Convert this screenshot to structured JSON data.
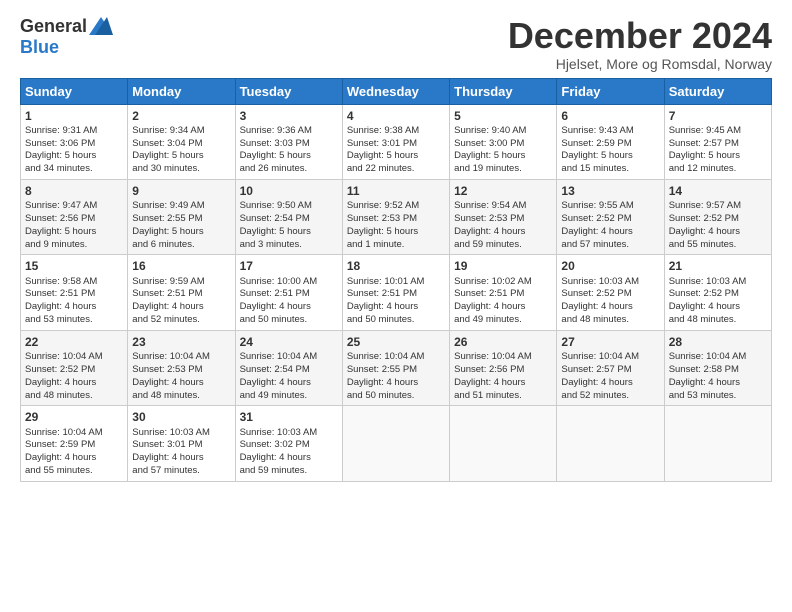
{
  "logo": {
    "general": "General",
    "blue": "Blue"
  },
  "title": "December 2024",
  "location": "Hjelset, More og Romsdal, Norway",
  "days_header": [
    "Sunday",
    "Monday",
    "Tuesday",
    "Wednesday",
    "Thursday",
    "Friday",
    "Saturday"
  ],
  "weeks": [
    [
      {
        "day": "1",
        "lines": [
          "Sunrise: 9:31 AM",
          "Sunset: 3:06 PM",
          "Daylight: 5 hours",
          "and 34 minutes."
        ]
      },
      {
        "day": "2",
        "lines": [
          "Sunrise: 9:34 AM",
          "Sunset: 3:04 PM",
          "Daylight: 5 hours",
          "and 30 minutes."
        ]
      },
      {
        "day": "3",
        "lines": [
          "Sunrise: 9:36 AM",
          "Sunset: 3:03 PM",
          "Daylight: 5 hours",
          "and 26 minutes."
        ]
      },
      {
        "day": "4",
        "lines": [
          "Sunrise: 9:38 AM",
          "Sunset: 3:01 PM",
          "Daylight: 5 hours",
          "and 22 minutes."
        ]
      },
      {
        "day": "5",
        "lines": [
          "Sunrise: 9:40 AM",
          "Sunset: 3:00 PM",
          "Daylight: 5 hours",
          "and 19 minutes."
        ]
      },
      {
        "day": "6",
        "lines": [
          "Sunrise: 9:43 AM",
          "Sunset: 2:59 PM",
          "Daylight: 5 hours",
          "and 15 minutes."
        ]
      },
      {
        "day": "7",
        "lines": [
          "Sunrise: 9:45 AM",
          "Sunset: 2:57 PM",
          "Daylight: 5 hours",
          "and 12 minutes."
        ]
      }
    ],
    [
      {
        "day": "8",
        "lines": [
          "Sunrise: 9:47 AM",
          "Sunset: 2:56 PM",
          "Daylight: 5 hours",
          "and 9 minutes."
        ]
      },
      {
        "day": "9",
        "lines": [
          "Sunrise: 9:49 AM",
          "Sunset: 2:55 PM",
          "Daylight: 5 hours",
          "and 6 minutes."
        ]
      },
      {
        "day": "10",
        "lines": [
          "Sunrise: 9:50 AM",
          "Sunset: 2:54 PM",
          "Daylight: 5 hours",
          "and 3 minutes."
        ]
      },
      {
        "day": "11",
        "lines": [
          "Sunrise: 9:52 AM",
          "Sunset: 2:53 PM",
          "Daylight: 5 hours",
          "and 1 minute."
        ]
      },
      {
        "day": "12",
        "lines": [
          "Sunrise: 9:54 AM",
          "Sunset: 2:53 PM",
          "Daylight: 4 hours",
          "and 59 minutes."
        ]
      },
      {
        "day": "13",
        "lines": [
          "Sunrise: 9:55 AM",
          "Sunset: 2:52 PM",
          "Daylight: 4 hours",
          "and 57 minutes."
        ]
      },
      {
        "day": "14",
        "lines": [
          "Sunrise: 9:57 AM",
          "Sunset: 2:52 PM",
          "Daylight: 4 hours",
          "and 55 minutes."
        ]
      }
    ],
    [
      {
        "day": "15",
        "lines": [
          "Sunrise: 9:58 AM",
          "Sunset: 2:51 PM",
          "Daylight: 4 hours",
          "and 53 minutes."
        ]
      },
      {
        "day": "16",
        "lines": [
          "Sunrise: 9:59 AM",
          "Sunset: 2:51 PM",
          "Daylight: 4 hours",
          "and 52 minutes."
        ]
      },
      {
        "day": "17",
        "lines": [
          "Sunrise: 10:00 AM",
          "Sunset: 2:51 PM",
          "Daylight: 4 hours",
          "and 50 minutes."
        ]
      },
      {
        "day": "18",
        "lines": [
          "Sunrise: 10:01 AM",
          "Sunset: 2:51 PM",
          "Daylight: 4 hours",
          "and 50 minutes."
        ]
      },
      {
        "day": "19",
        "lines": [
          "Sunrise: 10:02 AM",
          "Sunset: 2:51 PM",
          "Daylight: 4 hours",
          "and 49 minutes."
        ]
      },
      {
        "day": "20",
        "lines": [
          "Sunrise: 10:03 AM",
          "Sunset: 2:52 PM",
          "Daylight: 4 hours",
          "and 48 minutes."
        ]
      },
      {
        "day": "21",
        "lines": [
          "Sunrise: 10:03 AM",
          "Sunset: 2:52 PM",
          "Daylight: 4 hours",
          "and 48 minutes."
        ]
      }
    ],
    [
      {
        "day": "22",
        "lines": [
          "Sunrise: 10:04 AM",
          "Sunset: 2:52 PM",
          "Daylight: 4 hours",
          "and 48 minutes."
        ]
      },
      {
        "day": "23",
        "lines": [
          "Sunrise: 10:04 AM",
          "Sunset: 2:53 PM",
          "Daylight: 4 hours",
          "and 48 minutes."
        ]
      },
      {
        "day": "24",
        "lines": [
          "Sunrise: 10:04 AM",
          "Sunset: 2:54 PM",
          "Daylight: 4 hours",
          "and 49 minutes."
        ]
      },
      {
        "day": "25",
        "lines": [
          "Sunrise: 10:04 AM",
          "Sunset: 2:55 PM",
          "Daylight: 4 hours",
          "and 50 minutes."
        ]
      },
      {
        "day": "26",
        "lines": [
          "Sunrise: 10:04 AM",
          "Sunset: 2:56 PM",
          "Daylight: 4 hours",
          "and 51 minutes."
        ]
      },
      {
        "day": "27",
        "lines": [
          "Sunrise: 10:04 AM",
          "Sunset: 2:57 PM",
          "Daylight: 4 hours",
          "and 52 minutes."
        ]
      },
      {
        "day": "28",
        "lines": [
          "Sunrise: 10:04 AM",
          "Sunset: 2:58 PM",
          "Daylight: 4 hours",
          "and 53 minutes."
        ]
      }
    ],
    [
      {
        "day": "29",
        "lines": [
          "Sunrise: 10:04 AM",
          "Sunset: 2:59 PM",
          "Daylight: 4 hours",
          "and 55 minutes."
        ]
      },
      {
        "day": "30",
        "lines": [
          "Sunrise: 10:03 AM",
          "Sunset: 3:01 PM",
          "Daylight: 4 hours",
          "and 57 minutes."
        ]
      },
      {
        "day": "31",
        "lines": [
          "Sunrise: 10:03 AM",
          "Sunset: 3:02 PM",
          "Daylight: 4 hours",
          "and 59 minutes."
        ]
      },
      null,
      null,
      null,
      null
    ]
  ]
}
